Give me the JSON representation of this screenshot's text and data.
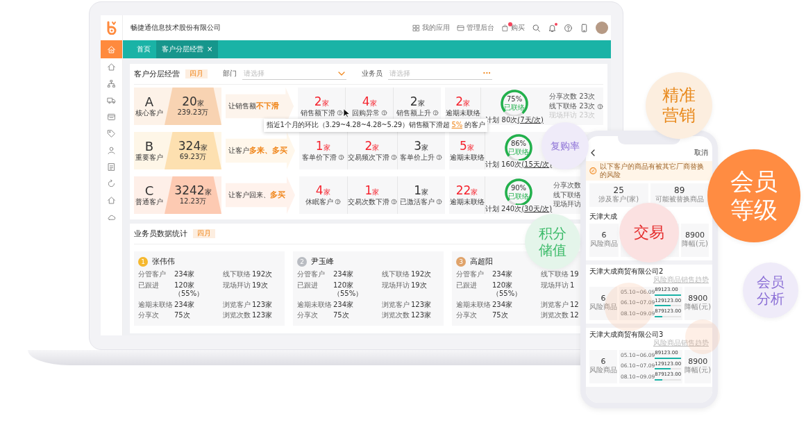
{
  "app": {
    "company": "畅捷通信息技术股份有限公司",
    "links": [
      {
        "kind": "apps",
        "label": "我的应用"
      },
      {
        "kind": "admin",
        "label": "管理后台"
      },
      {
        "kind": "buy",
        "label": "购买",
        "badge": true
      }
    ],
    "tools": [
      {
        "kind": "search"
      },
      {
        "kind": "bell",
        "dot": true
      },
      {
        "kind": "help"
      },
      {
        "kind": "device"
      }
    ]
  },
  "sidebar": {
    "items": [
      {
        "kind": "home",
        "selected": true
      },
      {
        "kind": "house",
        "selected": false
      },
      {
        "kind": "hierarchy",
        "selected": false
      },
      {
        "kind": "truck",
        "selected": false
      },
      {
        "kind": "window",
        "selected": false
      },
      {
        "kind": "tag",
        "selected": false
      },
      {
        "kind": "person",
        "selected": false
      },
      {
        "kind": "document",
        "selected": false
      },
      {
        "kind": "refresh",
        "selected": false
      },
      {
        "kind": "house",
        "selected": false
      },
      {
        "kind": "cloud",
        "selected": false
      }
    ]
  },
  "tabs": [
    {
      "label": "首页",
      "selected": false
    },
    {
      "label": "客户分层经营",
      "selected": true,
      "close": "×"
    }
  ],
  "layering": {
    "title": "客户分层经营",
    "period": "四月",
    "filters": [
      {
        "kind": "select",
        "label": "部门",
        "placeholder": "请选择"
      },
      {
        "kind": "more",
        "label": "业务员",
        "placeholder": "请选择",
        "more": "···"
      }
    ],
    "tiers": [
      {
        "letter": "A",
        "name": "核心客户",
        "color": "#f8d3b2",
        "count": "20",
        "unit": "家",
        "amount": "239.23万",
        "slogan": "让销售额**不下滑**",
        "metrics": [
          {
            "value": "2",
            "unit": "家",
            "label": "销售额下滑",
            "alert": true,
            "help": true
          },
          {
            "value": "4",
            "unit": "家",
            "label": "回购异常",
            "alert": true,
            "help": true
          },
          {
            "value": "2",
            "unit": "家",
            "label": "销售额上升",
            "alert": false,
            "help": true
          }
        ],
        "overdue": {
          "value": "2",
          "unit": "家",
          "label": "逾期未联络"
        },
        "gauge": {
          "level": 0.75,
          "percent": "75%",
          "status": "已联络"
        },
        "plan": {
          "label": "计划",
          "count": "80次",
          "cycle": "(7天/次)"
        },
        "side_stats": [
          {
            "label": "分享次数",
            "value": "23次",
            "help": false,
            "faded": false
          },
          {
            "label": "线下联络",
            "value": "23次",
            "help": true,
            "faded": false
          },
          {
            "label": "现场拜访",
            "value": "23次",
            "help": false,
            "faded": true
          }
        ]
      },
      {
        "letter": "B",
        "name": "重要客户",
        "color": "#fde0b0",
        "count": "324",
        "unit": "家",
        "amount": "69.23万",
        "slogan": "让客户**多来、多买**",
        "metrics": [
          {
            "value": "1",
            "unit": "家",
            "label": "客单价下滑",
            "alert": true,
            "help": true
          },
          {
            "value": "2",
            "unit": "家",
            "label": "交易频次下滑",
            "alert": true,
            "help": true
          },
          {
            "value": "3",
            "unit": "家",
            "label": "客单价上升",
            "alert": false,
            "help": true
          }
        ],
        "overdue": {
          "value": "5",
          "unit": "家",
          "label": "逾期未联络"
        },
        "gauge": {
          "level": 0.86,
          "percent": "86%",
          "status": "已联络"
        },
        "plan": {
          "label": "计划",
          "count": "160次",
          "cycle": "(15天/次)"
        }
      },
      {
        "letter": "C",
        "name": "普通客户",
        "color": "#fdcab2",
        "count": "3242",
        "unit": "家",
        "amount": "12.23万",
        "slogan": "让客户回来、**多买**",
        "metrics": [
          {
            "value": "4",
            "unit": "家",
            "label": "休眠客户",
            "alert": true,
            "help": true
          },
          {
            "value": "1",
            "unit": "家",
            "label": "交易次数下滑",
            "alert": true,
            "help": true
          },
          {
            "value": "1",
            "unit": "家",
            "label": "已激活客户",
            "alert": false,
            "help": true
          }
        ],
        "overdue": {
          "value": "22",
          "unit": "家",
          "label": "逾期未联络"
        },
        "gauge": {
          "level": 0.9,
          "percent": "90%",
          "status": "已联络"
        },
        "plan": {
          "label": "计划",
          "count": "240次",
          "cycle": "(30天/次)"
        },
        "side_stats": [
          {
            "label": "分享次数",
            "help": false,
            "faded": false
          },
          {
            "label": "线下联络",
            "help": false,
            "faded": false
          },
          {
            "label": "现场拜访",
            "help": false,
            "faded": false
          }
        ]
      }
    ],
    "tooltip": {
      "text": "指近1个月的环比（3.29~4.28~4.28~5.29）销售额下滑超 **5%** 的客户"
    }
  },
  "sales_stats": {
    "title": "业务员数据统计",
    "period": "四月",
    "people": [
      {
        "rank": "1",
        "name": "张伟伟",
        "color": "#f5b82e",
        "rows": [
          [
            "分管客户",
            "234家",
            "线下联络",
            "192次"
          ],
          [
            "已跟进",
            "120家（55%）",
            "现场拜访",
            "19次"
          ],
          [
            "逾期未联络",
            "234家",
            "浏览客户",
            "123家"
          ],
          [
            "分享次",
            "75次",
            "浏览次数",
            "123家"
          ]
        ]
      },
      {
        "rank": "2",
        "name": "尹玉峰",
        "color": "#b9bcc2",
        "rows": [
          [
            "分管客户",
            "234家",
            "线下联络",
            "192次"
          ],
          [
            "已跟进",
            "120家（55%）",
            "现场拜访",
            "19次"
          ],
          [
            "逾期未联络",
            "234家",
            "浏览客户",
            "123家"
          ],
          [
            "分享次",
            "75次",
            "浏览次数",
            "123家"
          ]
        ]
      },
      {
        "rank": "3",
        "name": "高超阳",
        "color": "#e0a36a",
        "rows": [
          [
            "分管客户",
            "234家",
            "线下联络",
            "19"
          ],
          [
            "已跟进",
            "120家（55%）",
            "现场拜访",
            "1"
          ],
          [
            "逾期未联络",
            "234家",
            "浏览客户",
            "12"
          ],
          [
            "分享次",
            "75次",
            "浏览次数",
            "12"
          ]
        ]
      }
    ]
  },
  "phone": {
    "cancel": "取消",
    "notice": "以下客户的商品有被其它厂商替换的风险",
    "stats": [
      {
        "value": "25",
        "label": "涉及客户(家)"
      },
      {
        "value": "89",
        "label": "可能被替换商品"
      }
    ],
    "cards": [
      {
        "title": "天津大成",
        "risk_value": "6",
        "risk_label": "风险商品",
        "drop_value": "8900",
        "drop_label": "降幅(元)"
      },
      {
        "title": "天津大成商贸有限公司2",
        "trend": "风险商品销售趋势",
        "risk_value": "6",
        "risk_label": "风险商品",
        "drop_value": "8900",
        "drop_label": "降幅(元)",
        "periods": [
          {
            "range": "05.10~06.09",
            "amount": "89123.00",
            "level": 1.0
          },
          {
            "range": "06.10~07.09",
            "amount": "129123.00",
            "level": 0.6
          },
          {
            "range": "08.10~09.09",
            "amount": "879123.00",
            "level": 0.28
          }
        ]
      },
      {
        "title": "天津大成商贸有限公司3",
        "trend": "风险商品销售趋势",
        "risk_value": "6",
        "risk_label": "风险商品",
        "drop_value": "8900",
        "drop_label": "降幅(元)",
        "periods": [
          {
            "range": "05.10~06.09",
            "amount": "89123.00",
            "level": 1.0
          },
          {
            "range": "06.10~07.09",
            "amount": "129123.00",
            "level": 0.6
          },
          {
            "range": "08.10~09.09",
            "amount": "879123.00",
            "level": 0.28
          }
        ]
      }
    ]
  },
  "bubbles": [
    {
      "lines": [
        "精准",
        "营销"
      ],
      "kind": "soft",
      "color": "#e8891c"
    },
    {
      "lines": [
        "复购率"
      ],
      "kind": "soft",
      "color": "#8b6fd6"
    },
    {
      "lines": [
        "会员",
        "等级"
      ],
      "kind": "solid",
      "color": "#ff8c42"
    },
    {
      "lines": [
        "积分",
        "储值"
      ],
      "kind": "soft",
      "color": "#3dbb6a"
    },
    {
      "lines": [
        "交易"
      ],
      "kind": "soft",
      "color": "#e52a2a"
    },
    {
      "lines": [
        "会员",
        "分析"
      ],
      "kind": "soft",
      "color": "#8b6fd6"
    }
  ]
}
